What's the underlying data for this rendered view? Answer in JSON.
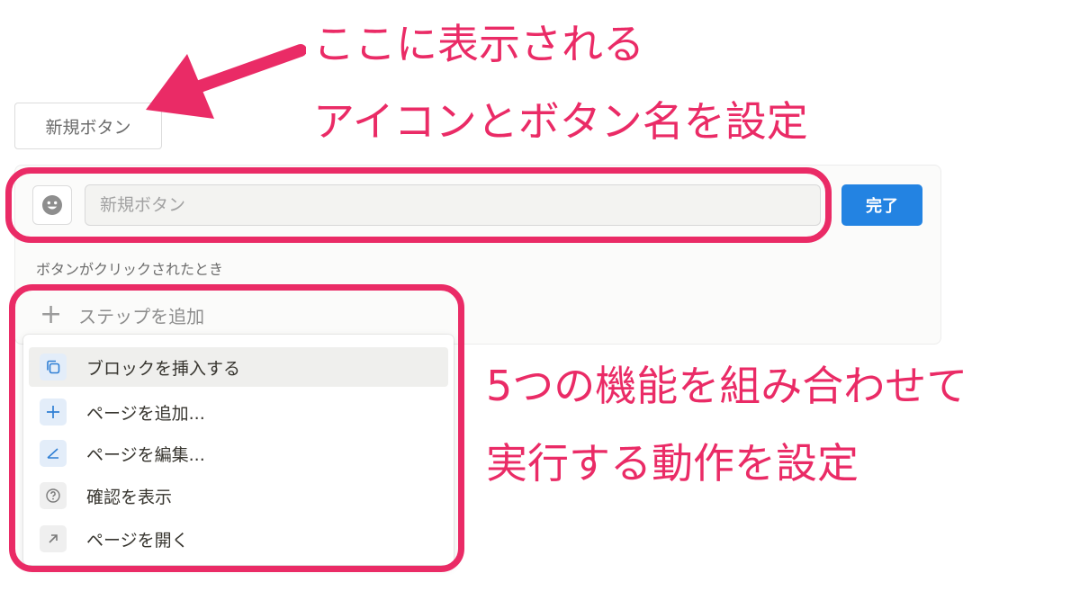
{
  "preview": {
    "label": "新規ボタン"
  },
  "editor": {
    "icon_name": "smiley-icon",
    "name_placeholder": "新規ボタン",
    "done_label": "完了",
    "trigger_label": "ボタンがクリックされたとき",
    "add_step_label": "ステップを追加"
  },
  "menu": {
    "items": [
      {
        "label": "ブロックを挿入する",
        "icon": "copy-blocks-icon"
      },
      {
        "label": "ページを追加...",
        "icon": "plus-icon"
      },
      {
        "label": "ページを編集...",
        "icon": "edit-icon"
      },
      {
        "label": "確認を表示",
        "icon": "question-icon"
      },
      {
        "label": "ページを開く",
        "icon": "arrow-up-right-icon"
      }
    ]
  },
  "annotations": {
    "top_line1": "ここに表示される",
    "top_line2": "アイコンとボタン名を設定",
    "bottom_line1": "5つの機能を組み合わせて",
    "bottom_line2": "実行する動作を設定"
  },
  "colors": {
    "accent": "#ea2b66",
    "primary_button": "#2383e2"
  }
}
